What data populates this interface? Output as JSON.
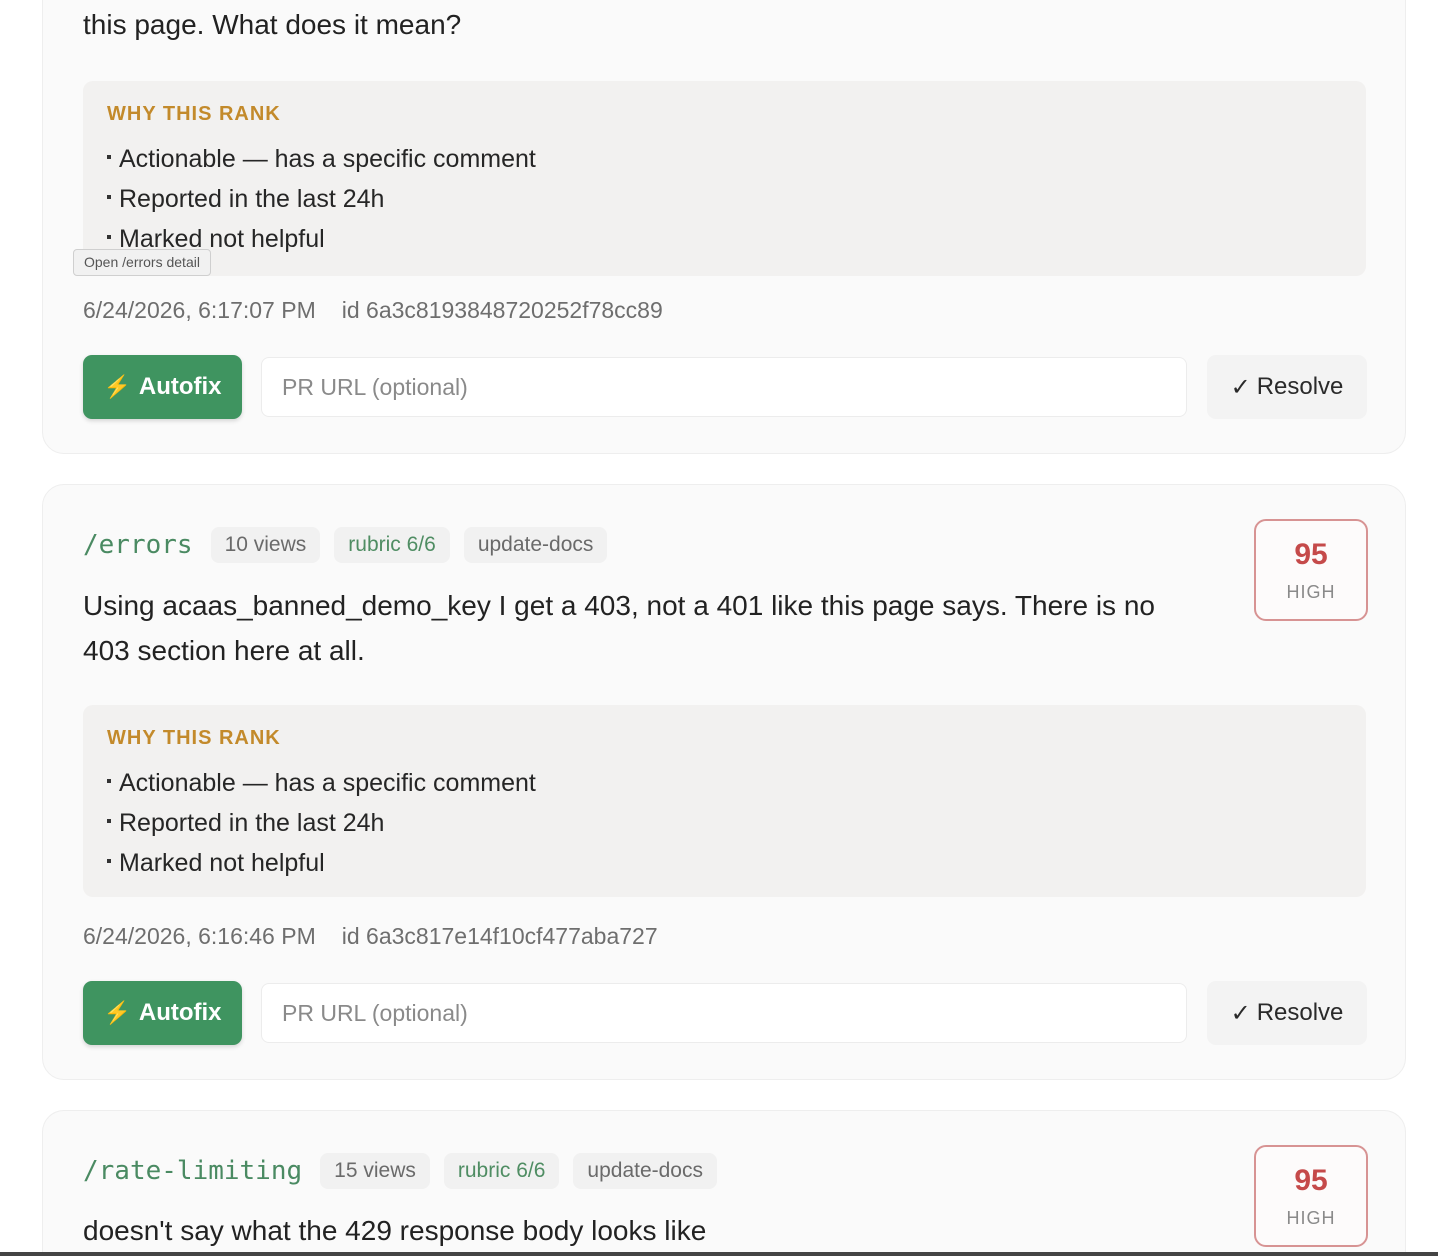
{
  "tooltip": "Open /errors detail",
  "cards": [
    {
      "comment": "this page. What does it mean?",
      "why_title": "WHY THIS RANK",
      "reasons": [
        "Actionable — has a specific comment",
        "Reported in the last 24h",
        "Marked not helpful"
      ],
      "timestamp": "6/24/2026, 6:17:07 PM",
      "id": "id 6a3c8193848720252f78cc89",
      "autofix_label": "Autofix",
      "pr_placeholder": "PR URL (optional)",
      "resolve_label": "Resolve"
    },
    {
      "path": "/errors",
      "views": "10 views",
      "rubric": "rubric 6/6",
      "action": "update-docs",
      "score": "95",
      "level": "HIGH",
      "comment_line1": "Using acaas_banned_demo_key I get a 403, not a 401 like this page says. There is no",
      "comment_line2": "403 section here at all.",
      "why_title": "WHY THIS RANK",
      "reasons": [
        "Actionable — has a specific comment",
        "Reported in the last 24h",
        "Marked not helpful"
      ],
      "timestamp": "6/24/2026, 6:16:46 PM",
      "id": "id 6a3c817e14f10cf477aba727",
      "autofix_label": "Autofix",
      "pr_placeholder": "PR URL (optional)",
      "resolve_label": "Resolve"
    },
    {
      "path": "/rate-limiting",
      "views": "15 views",
      "rubric": "rubric 6/6",
      "action": "update-docs",
      "score": "95",
      "level": "HIGH",
      "comment": "doesn't say what the 429 response body looks like"
    }
  ],
  "colors": {
    "autofix_bg": "#3f9460",
    "path_green": "#4a8a62",
    "why_title": "#c38a2b",
    "score_red": "#c54a4a",
    "score_border": "#d79393"
  },
  "icons": {
    "autofix": "lightning-bolt-icon",
    "resolve": "checkmark-icon"
  }
}
